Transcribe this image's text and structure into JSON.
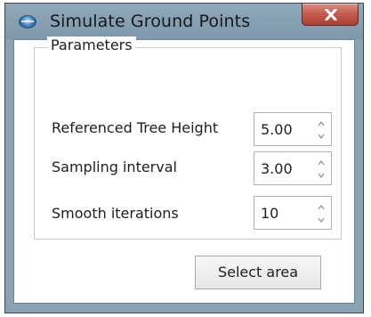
{
  "window": {
    "title": "Simulate Ground Points",
    "close_label": "×"
  },
  "parameters": {
    "group_title": "Parameters",
    "fields": [
      {
        "label": "Referenced Tree Height",
        "value": "5.00"
      },
      {
        "label": "Sampling interval",
        "value": "3.00"
      },
      {
        "label": "Smooth iterations",
        "value": "10"
      }
    ]
  },
  "actions": {
    "select_area_label": "Select area"
  },
  "colors": {
    "title_bar": "#89a2b4",
    "close_button": "#c25a4d",
    "client_background": "#ffffff"
  }
}
